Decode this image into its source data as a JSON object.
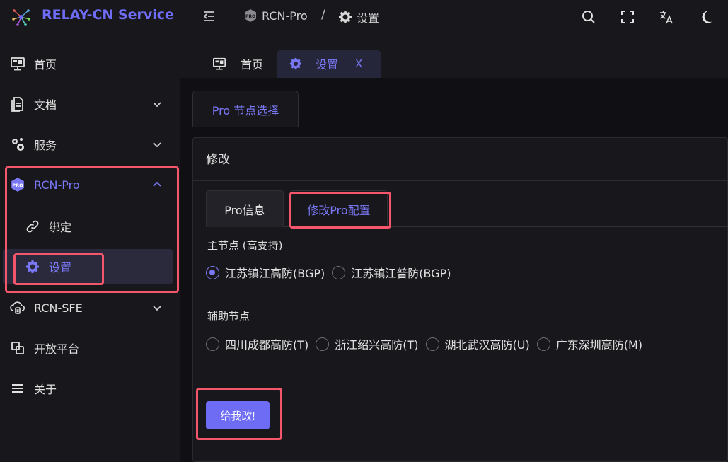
{
  "header": {
    "app_title": "RELAY-CN Service",
    "breadcrumb": [
      {
        "label": "RCN-Pro",
        "icon": "pro-badge-icon"
      },
      {
        "label": "设置",
        "icon": "gear-icon"
      }
    ],
    "breadcrumb_separator": "/",
    "actions": [
      "search-icon",
      "fullscreen-icon",
      "translate-icon",
      "dark-mode-icon"
    ]
  },
  "sidebar": {
    "items": [
      {
        "label": "首页",
        "icon": "monitor-icon",
        "expandable": false
      },
      {
        "label": "文档",
        "icon": "document-icon",
        "expandable": true
      },
      {
        "label": "服务",
        "icon": "services-icon",
        "expandable": true
      },
      {
        "label": "RCN-Pro",
        "icon": "pro-badge-icon",
        "expandable": true,
        "expanded": true,
        "children": [
          {
            "label": "绑定",
            "icon": "link-icon"
          },
          {
            "label": "设置",
            "icon": "gear-icon",
            "selected": true
          }
        ]
      },
      {
        "label": "RCN-SFE",
        "icon": "sfe-icon",
        "expandable": true
      },
      {
        "label": "开放平台",
        "icon": "open-platform-icon",
        "expandable": false
      },
      {
        "label": "关于",
        "icon": "menu-icon",
        "expandable": false
      }
    ]
  },
  "page_tabs": [
    {
      "label": "首页",
      "icon": "monitor-icon",
      "active": false
    },
    {
      "label": "设置",
      "icon": "gear-icon",
      "active": true,
      "close": "X"
    }
  ],
  "main": {
    "card_tab": "Pro 节点选择",
    "card_title": "修改",
    "inner_tabs": [
      "Pro信息",
      "修改Pro配置"
    ],
    "primary_section": {
      "label": "主节点 (高支持)",
      "options": [
        {
          "label": "江苏镇江高防(BGP)",
          "checked": true
        },
        {
          "label": "江苏镇江普防(BGP)",
          "checked": false
        }
      ]
    },
    "secondary_section": {
      "label": "辅助节点",
      "options": [
        {
          "label": "四川成都高防(T)",
          "checked": false
        },
        {
          "label": "浙江绍兴高防(T)",
          "checked": false
        },
        {
          "label": "湖北武汉高防(U)",
          "checked": false
        },
        {
          "label": "广东深圳高防(M)",
          "checked": false
        }
      ]
    },
    "submit_label": "给我改!"
  },
  "colors": {
    "accent": "#6e6cf5",
    "annotation": "#f4566c",
    "background": "#18181c"
  }
}
